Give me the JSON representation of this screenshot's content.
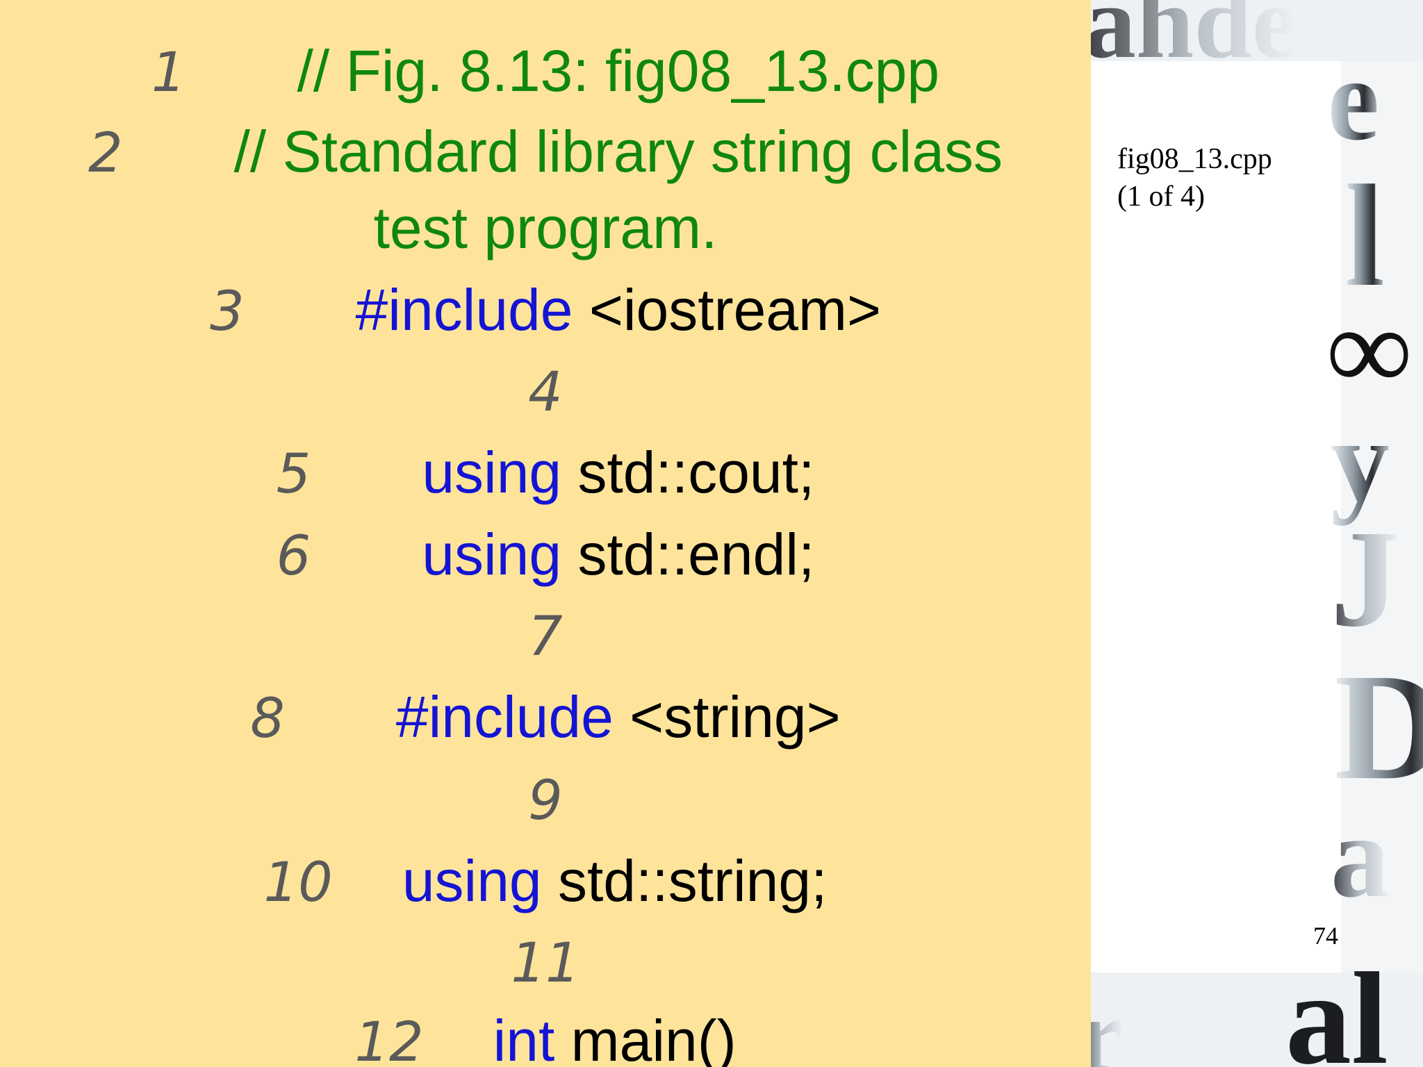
{
  "code": {
    "lines": [
      {
        "num": "1",
        "comment": "// Fig. 8.13: fig08_13.cpp"
      },
      {
        "num": "2",
        "comment_a": "// Standard library string class",
        "comment_b": "test program."
      },
      {
        "num": "3",
        "kw": "#include",
        "rest": " <iostream>"
      },
      {
        "num": "4"
      },
      {
        "num": "5",
        "kw": "using",
        "rest": " std::cout;"
      },
      {
        "num": "6",
        "kw": "using",
        "rest": " std::endl;"
      },
      {
        "num": "7"
      },
      {
        "num": "8",
        "kw": "#include",
        "rest": " <string>"
      },
      {
        "num": "9"
      },
      {
        "num": "10",
        "kw": "using",
        "rest": " std::string;"
      },
      {
        "num": "11"
      },
      {
        "num": "12",
        "kw": "int",
        "rest": " main()"
      }
    ]
  },
  "side": {
    "file_label": "fig08_13.cpp",
    "part_label": "(1 of 4)",
    "page_number": "74"
  },
  "colors": {
    "panel_background": "#fee49b",
    "comment": "#0f870f",
    "keyword": "#1414d4",
    "line_number": "#5a5a5a"
  }
}
